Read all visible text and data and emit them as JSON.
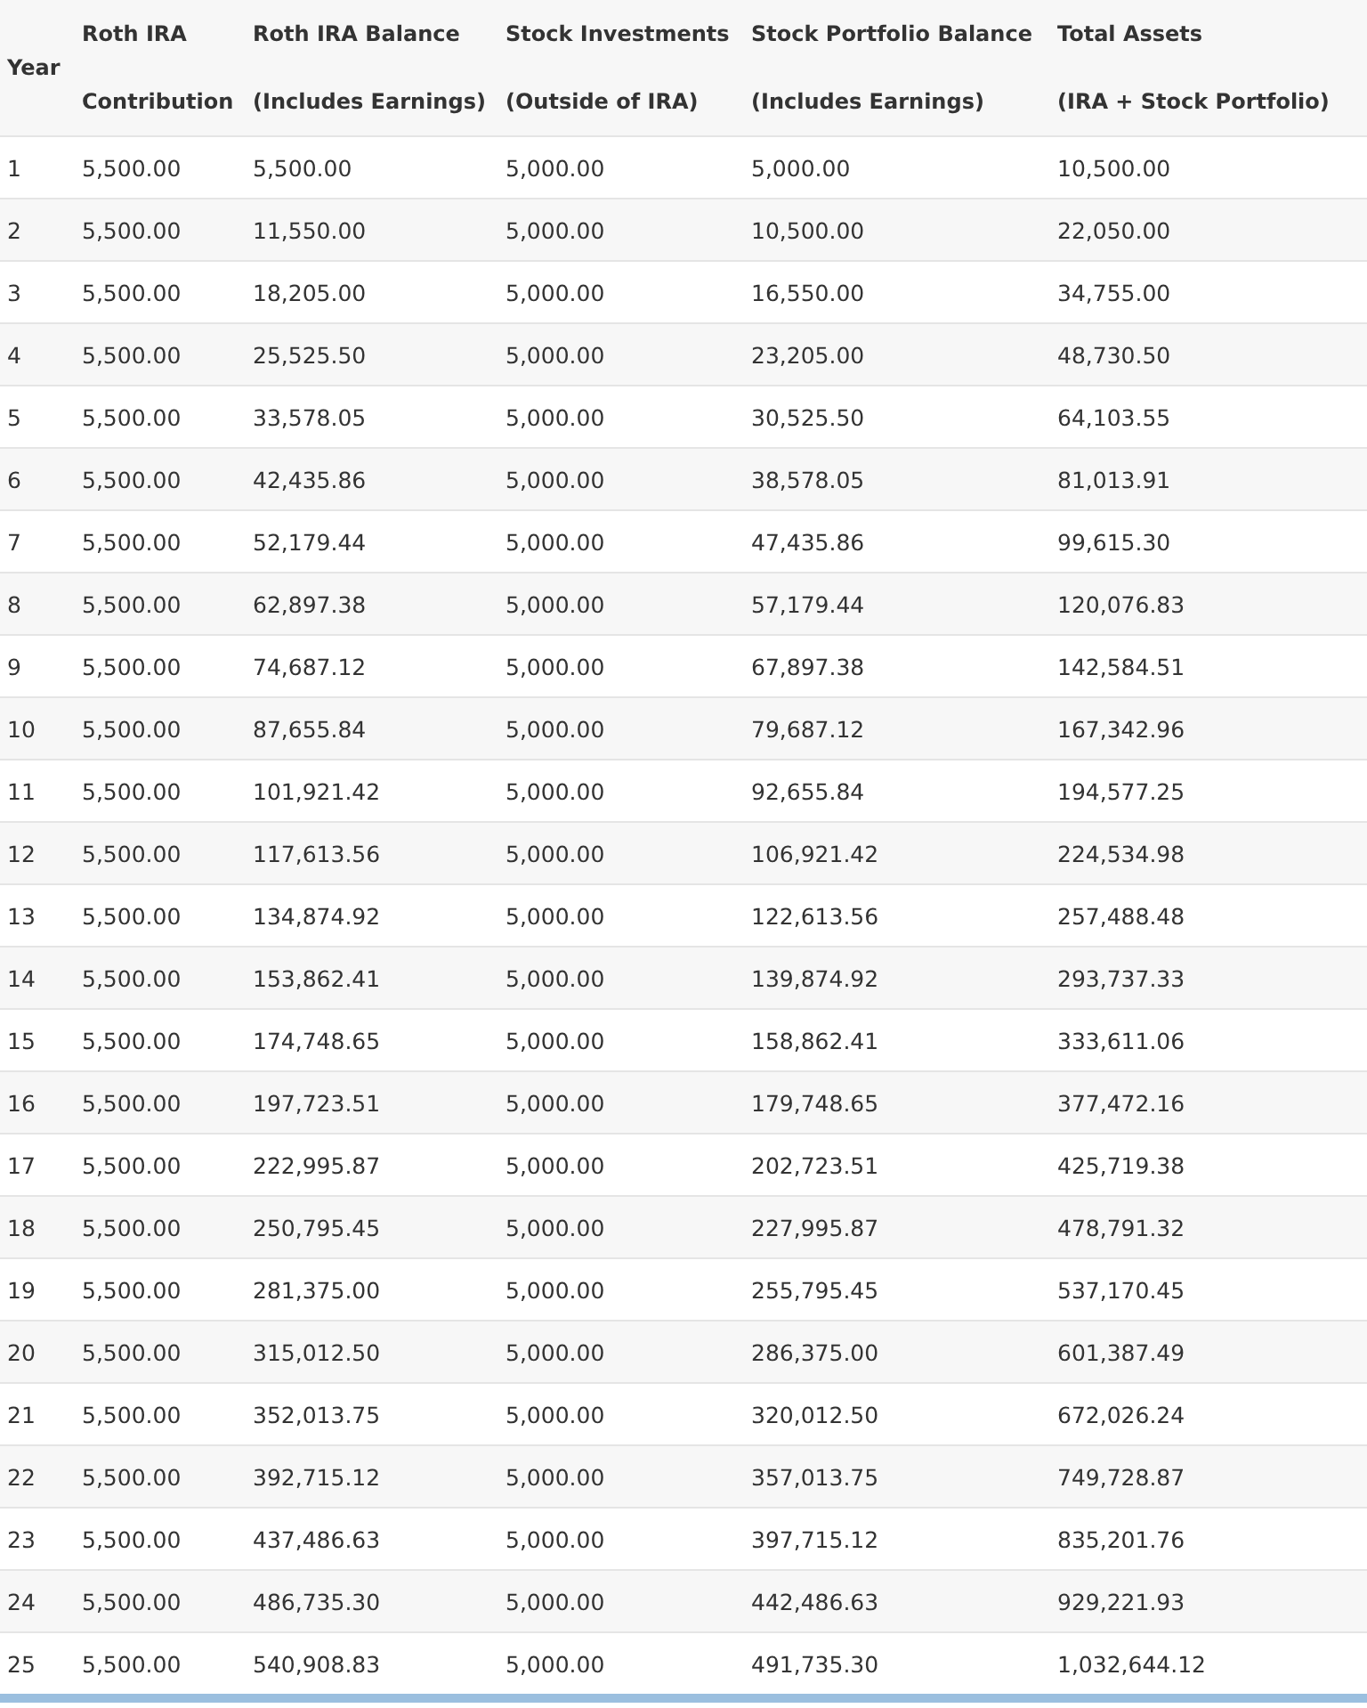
{
  "table": {
    "columns": [
      {
        "label": "Year"
      },
      {
        "label": "Roth IRA",
        "sublabel": "Contribution"
      },
      {
        "label": "Roth IRA Balance",
        "sublabel": "(Includes Earnings)"
      },
      {
        "label": "Stock Investments",
        "sublabel": "(Outside of IRA)"
      },
      {
        "label": "Stock Portfolio Balance",
        "sublabel": "(Includes Earnings)"
      },
      {
        "label": "Total Assets",
        "sublabel": "(IRA + Stock Portfolio)"
      }
    ],
    "rows": [
      [
        "1",
        "5,500.00",
        "5,500.00",
        "5,000.00",
        "5,000.00",
        "10,500.00"
      ],
      [
        "2",
        "5,500.00",
        "11,550.00",
        "5,000.00",
        "10,500.00",
        "22,050.00"
      ],
      [
        "3",
        "5,500.00",
        "18,205.00",
        "5,000.00",
        "16,550.00",
        "34,755.00"
      ],
      [
        "4",
        "5,500.00",
        "25,525.50",
        "5,000.00",
        "23,205.00",
        "48,730.50"
      ],
      [
        "5",
        "5,500.00",
        "33,578.05",
        "5,000.00",
        "30,525.50",
        "64,103.55"
      ],
      [
        "6",
        "5,500.00",
        "42,435.86",
        "5,000.00",
        "38,578.05",
        "81,013.91"
      ],
      [
        "7",
        "5,500.00",
        "52,179.44",
        "5,000.00",
        "47,435.86",
        "99,615.30"
      ],
      [
        "8",
        "5,500.00",
        "62,897.38",
        "5,000.00",
        "57,179.44",
        "120,076.83"
      ],
      [
        "9",
        "5,500.00",
        "74,687.12",
        "5,000.00",
        "67,897.38",
        "142,584.51"
      ],
      [
        "10",
        "5,500.00",
        "87,655.84",
        "5,000.00",
        "79,687.12",
        "167,342.96"
      ],
      [
        "11",
        "5,500.00",
        "101,921.42",
        "5,000.00",
        "92,655.84",
        "194,577.25"
      ],
      [
        "12",
        "5,500.00",
        "117,613.56",
        "5,000.00",
        "106,921.42",
        "224,534.98"
      ],
      [
        "13",
        "5,500.00",
        "134,874.92",
        "5,000.00",
        "122,613.56",
        "257,488.48"
      ],
      [
        "14",
        "5,500.00",
        "153,862.41",
        "5,000.00",
        "139,874.92",
        "293,737.33"
      ],
      [
        "15",
        "5,500.00",
        "174,748.65",
        "5,000.00",
        "158,862.41",
        "333,611.06"
      ],
      [
        "16",
        "5,500.00",
        "197,723.51",
        "5,000.00",
        "179,748.65",
        "377,472.16"
      ],
      [
        "17",
        "5,500.00",
        "222,995.87",
        "5,000.00",
        "202,723.51",
        "425,719.38"
      ],
      [
        "18",
        "5,500.00",
        "250,795.45",
        "5,000.00",
        "227,995.87",
        "478,791.32"
      ],
      [
        "19",
        "5,500.00",
        "281,375.00",
        "5,000.00",
        "255,795.45",
        "537,170.45"
      ],
      [
        "20",
        "5,500.00",
        "315,012.50",
        "5,000.00",
        "286,375.00",
        "601,387.49"
      ],
      [
        "21",
        "5,500.00",
        "352,013.75",
        "5,000.00",
        "320,012.50",
        "672,026.24"
      ],
      [
        "22",
        "5,500.00",
        "392,715.12",
        "5,000.00",
        "357,013.75",
        "749,728.87"
      ],
      [
        "23",
        "5,500.00",
        "437,486.63",
        "5,000.00",
        "397,715.12",
        "835,201.76"
      ],
      [
        "24",
        "5,500.00",
        "486,735.30",
        "5,000.00",
        "442,486.63",
        "929,221.93"
      ],
      [
        "25",
        "5,500.00",
        "540,908.83",
        "5,000.00",
        "491,735.30",
        "1,032,644.12"
      ]
    ]
  }
}
